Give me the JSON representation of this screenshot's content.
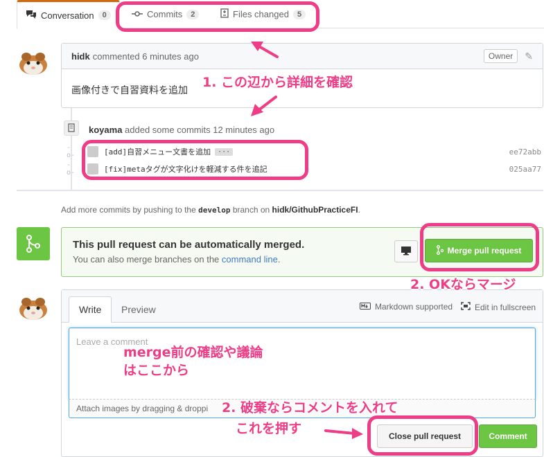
{
  "tabs": {
    "conversation": {
      "label": "Conversation",
      "count": "0"
    },
    "commits": {
      "label": "Commits",
      "count": "2"
    },
    "files": {
      "label": "Files changed",
      "count": "5"
    }
  },
  "comment": {
    "author": "hidk",
    "action": "commented 6 minutes ago",
    "badge": "Owner",
    "body": "画像付きで自習資料を追加"
  },
  "push_event": {
    "author": "koyama",
    "text": "added some commits 12 minutes ago"
  },
  "commits": [
    {
      "message": "[add]自習メニュー文書を追加",
      "sha": "ee72abb",
      "more": "···"
    },
    {
      "message": "[fix]metaタグが文字化けを軽減する件を追記",
      "sha": "025aa77"
    }
  ],
  "branch_info": {
    "prefix": "Add more commits by pushing to the",
    "branch": "develop",
    "middle": "branch on",
    "repo": "hidk/GithubPracticeFI",
    "suffix": "."
  },
  "merge": {
    "title": "This pull request can be automatically merged.",
    "subtitle": "You can also merge branches on the",
    "link": "command line",
    "subtitle_end": ".",
    "button": "Merge pull request"
  },
  "new_comment": {
    "tab_write": "Write",
    "tab_preview": "Preview",
    "markdown": "Markdown supported",
    "fullscreen": "Edit in fullscreen",
    "placeholder": "Leave a comment",
    "attach": "Attach images by dragging & droppi",
    "close_button": "Close pull request",
    "comment_button": "Comment"
  },
  "annotations": {
    "a1": "1. この辺から詳細を確認",
    "a2": "2. OKならマージ",
    "a3_line1": "merge前の確認や議論",
    "a3_line2": "はここから",
    "a4_line1": "2. 破棄ならコメントを入れて",
    "a4_line2": "これを押す"
  },
  "colors": {
    "accent_pink": "#ee3d86",
    "merge_green": "#6cc644",
    "link_blue": "#4078c0"
  }
}
